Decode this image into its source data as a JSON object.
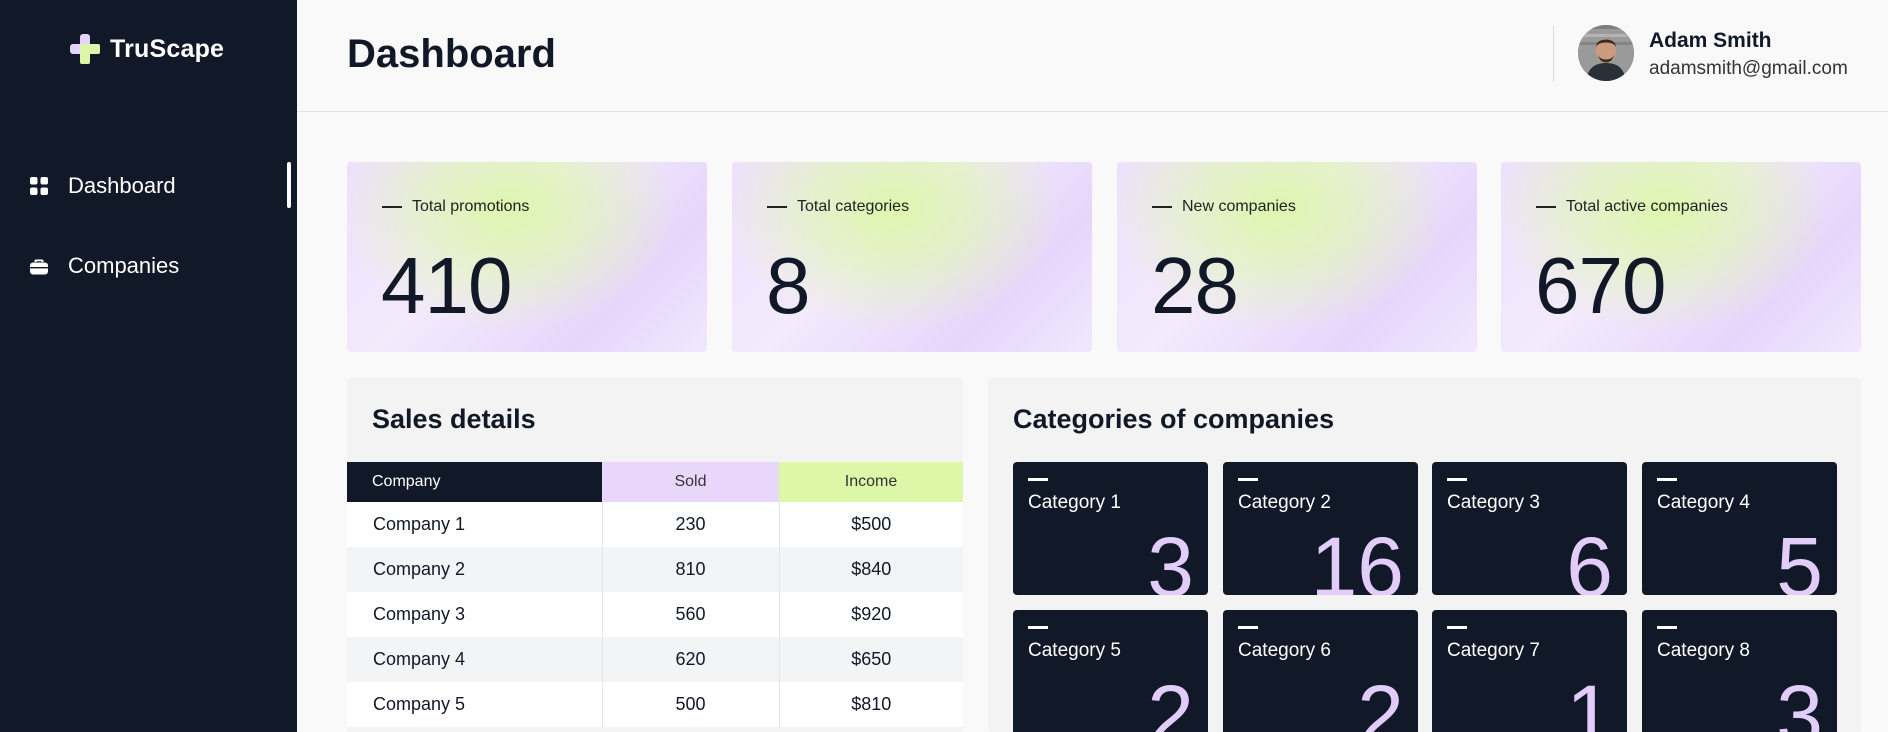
{
  "app": {
    "brand": "TruScape"
  },
  "sidebar": {
    "items": [
      {
        "label": "Dashboard",
        "icon": "grid-icon",
        "active": true
      },
      {
        "label": "Companies",
        "icon": "briefcase-icon",
        "active": false
      }
    ]
  },
  "header": {
    "title": "Dashboard",
    "user": {
      "name": "Adam Smith",
      "email": "adamsmith@gmail.com"
    }
  },
  "stats": [
    {
      "label": "Total promotions",
      "value": "410"
    },
    {
      "label": "Total categories",
      "value": "8"
    },
    {
      "label": "New companies",
      "value": "28"
    },
    {
      "label": "Total active companies",
      "value": "670"
    }
  ],
  "sales": {
    "title": "Sales details",
    "columns": [
      "Company",
      "Sold",
      "Income"
    ],
    "rows": [
      [
        "Company 1",
        "230",
        "$500"
      ],
      [
        "Company 2",
        "810",
        "$840"
      ],
      [
        "Company 3",
        "560",
        "$920"
      ],
      [
        "Company 4",
        "620",
        "$650"
      ],
      [
        "Company 5",
        "500",
        "$810"
      ]
    ]
  },
  "categories": {
    "title": "Categories of companies",
    "items": [
      {
        "name": "Category 1",
        "count": "3"
      },
      {
        "name": "Category 2",
        "count": "16"
      },
      {
        "name": "Category 3",
        "count": "6"
      },
      {
        "name": "Category 4",
        "count": "5"
      },
      {
        "name": "Category 5",
        "count": "2"
      },
      {
        "name": "Category 6",
        "count": "2"
      },
      {
        "name": "Category 7",
        "count": "1"
      },
      {
        "name": "Category 8",
        "count": "3"
      }
    ]
  },
  "colors": {
    "sidebar_bg": "#111827",
    "accent_lilac": "#e9d7fb",
    "accent_lime": "#dcf7a8",
    "tile_count": "#e2cdfa"
  }
}
